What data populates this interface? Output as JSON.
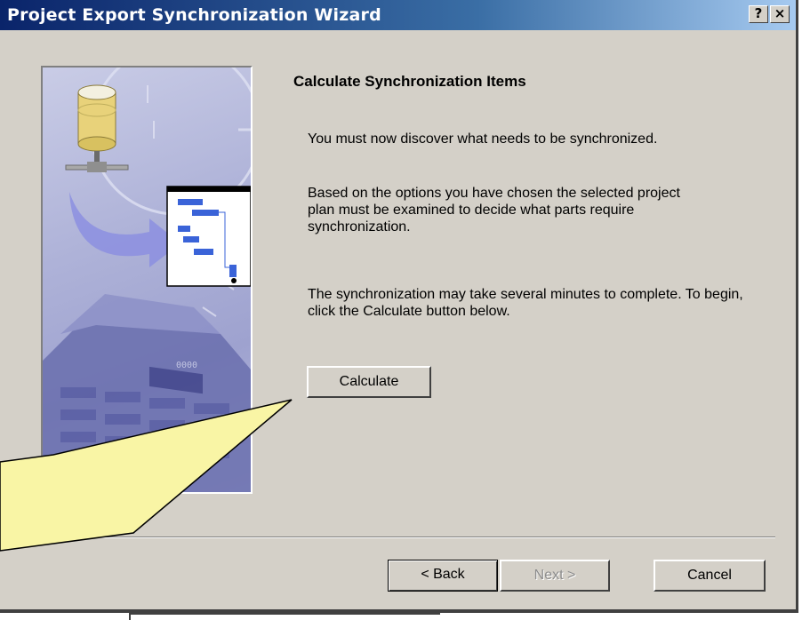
{
  "window": {
    "title": "Project Export Synchronization Wizard",
    "help_label": "?",
    "close_label": "×"
  },
  "content": {
    "heading": "Calculate Synchronization Items",
    "paragraph1": "You must now discover what needs to be synchronized.",
    "paragraph2": "Based on the options you have chosen the selected project plan must be examined to decide what parts require synchronization.",
    "paragraph3": "The synchronization may take several minutes to complete.  To begin, click the Calculate button below.",
    "calculate_label": "Calculate"
  },
  "footer": {
    "back_label": "< Back",
    "next_label": "Next >",
    "cancel_label": "Cancel"
  },
  "art": {
    "icons": [
      "database-icon",
      "gantt-chart-icon",
      "calculator-icon",
      "arrow-icon"
    ],
    "calculator_display": "0000"
  },
  "colors": {
    "titlebar_start": "#0a246a",
    "titlebar_end": "#a6caf0",
    "dialog_face": "#d4d0c8",
    "art_background": "#aeb2d8",
    "callout_fill": "#f9f5a5"
  }
}
